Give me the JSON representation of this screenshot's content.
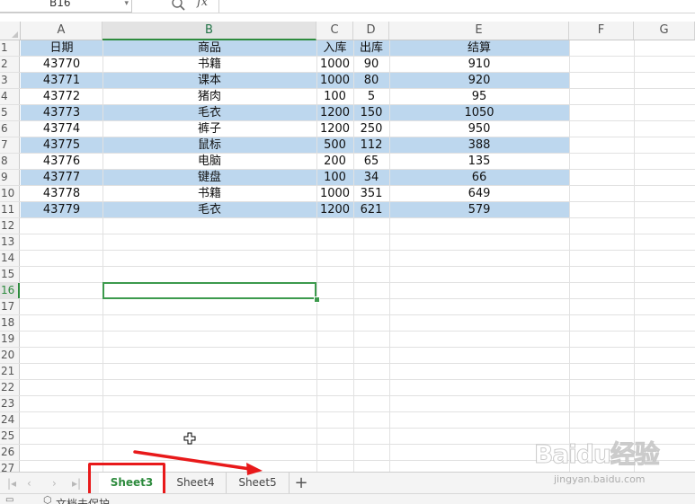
{
  "name_box": {
    "value": "B16"
  },
  "formula_bar": {
    "fx_label": "fx"
  },
  "columns": [
    "A",
    "B",
    "C",
    "D",
    "E",
    "F",
    "G"
  ],
  "selected_column": "B",
  "selected_row": "16",
  "table": {
    "headers": [
      "日期",
      "商品",
      "入库",
      "出库",
      "结算"
    ],
    "rows": [
      [
        "43770",
        "书籍",
        "1000",
        "90",
        "910"
      ],
      [
        "43771",
        "课本",
        "1000",
        "80",
        "920"
      ],
      [
        "43772",
        "猪肉",
        "100",
        "5",
        "95"
      ],
      [
        "43773",
        "毛衣",
        "1200",
        "150",
        "1050"
      ],
      [
        "43774",
        "裤子",
        "1200",
        "250",
        "950"
      ],
      [
        "43775",
        "鼠标",
        "500",
        "112",
        "388"
      ],
      [
        "43776",
        "电脑",
        "200",
        "65",
        "135"
      ],
      [
        "43777",
        "键盘",
        "100",
        "34",
        "66"
      ],
      [
        "43778",
        "书籍",
        "1000",
        "351",
        "649"
      ],
      [
        "43779",
        "毛衣",
        "1200",
        "621",
        "579"
      ]
    ]
  },
  "row_numbers": [
    "1",
    "2",
    "3",
    "4",
    "5",
    "6",
    "7",
    "8",
    "9",
    "10",
    "11",
    "12",
    "13",
    "14",
    "15",
    "16",
    "17",
    "18",
    "19",
    "20",
    "21",
    "22",
    "23",
    "24",
    "25",
    "26",
    "27"
  ],
  "sheet_tabs": [
    {
      "label": "Sheet3",
      "active": true
    },
    {
      "label": "Sheet4",
      "active": false
    },
    {
      "label": "Sheet5",
      "active": false
    }
  ],
  "add_sheet_label": "+",
  "status": {
    "text": "文档未保护"
  },
  "watermark": {
    "logo": "Baidu经验",
    "url": "jingyan.baidu.com"
  },
  "colors": {
    "band": "#bdd7ee",
    "selection": "#2e8b3e",
    "annotation": "#e8191a"
  },
  "icons": [
    "zoom-icon",
    "fx-icon",
    "cell-cursor-icon",
    "add-sheet-icon",
    "first-sheet-icon",
    "prev-sheet-icon",
    "next-sheet-icon",
    "last-sheet-icon"
  ]
}
